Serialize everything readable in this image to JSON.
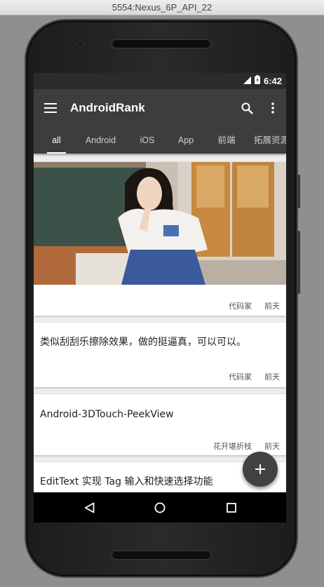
{
  "window": {
    "title": "5554:Nexus_6P_API_22"
  },
  "statusbar": {
    "time": "6:42"
  },
  "appbar": {
    "title": "AndroidRank"
  },
  "tabs": [
    {
      "label": "all"
    },
    {
      "label": "Android"
    },
    {
      "label": "iOS"
    },
    {
      "label": "App"
    },
    {
      "label": "前端"
    },
    {
      "label": "拓展资源"
    }
  ],
  "feed": {
    "items": [
      {
        "title": "",
        "author": "代码家",
        "time": "前天"
      },
      {
        "title": "类似刮刮乐擦除效果，做的挺逼真，可以可以。",
        "author": "代码家",
        "time": "前天"
      },
      {
        "title": "Android-3DTouch-PeekView",
        "author": "花开堪折枝",
        "time": "前天"
      },
      {
        "title": "EditText 实现 Tag 输入和快速选择功能",
        "author": "",
        "time": ""
      }
    ]
  },
  "colors": {
    "appbar": "#3d3d3d",
    "statusbar": "#2b2b2b",
    "fab": "#424242",
    "background": "#eeeeee"
  }
}
